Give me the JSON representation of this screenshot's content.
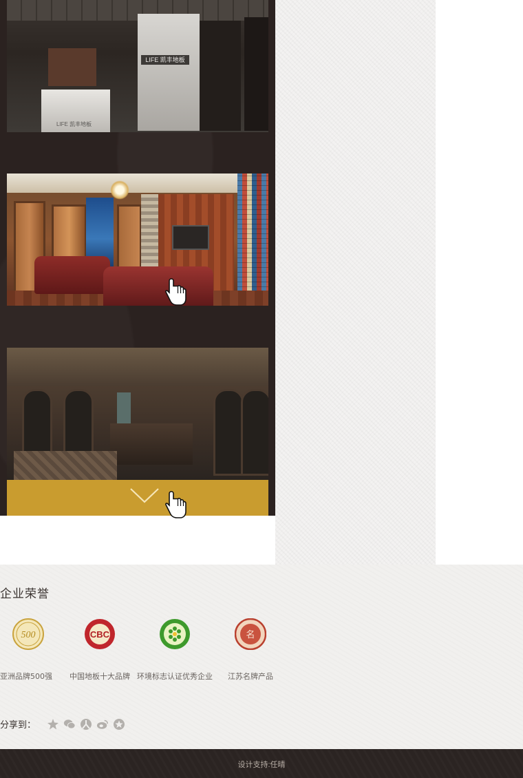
{
  "gallery": {
    "photo1_logo_text": "LIFE 凯丰地板",
    "photo1_desk_text": "LIFE 凯丰地板",
    "scroll_button_icon": "chevron-down-icon"
  },
  "honors": {
    "title": "企业荣誉",
    "awards": [
      {
        "name": "亚洲品牌500强",
        "medal_text": "500"
      },
      {
        "name": "中国地板十大品牌",
        "medal_text": "CBC"
      },
      {
        "name": "环境标志认证优秀企业",
        "medal_text": ""
      },
      {
        "name": "江苏名牌产品",
        "medal_text": "名"
      }
    ]
  },
  "share": {
    "label": "分享到：",
    "icons": [
      "qzone-icon",
      "wechat-icon",
      "renren-icon",
      "weibo-icon",
      "favorite-icon"
    ]
  },
  "footer": {
    "credit": "设计支持:任晴"
  },
  "colors": {
    "gallery_bg": "#2b2220",
    "accent_gold": "#c99c2f",
    "footer_bg": "#2b2422"
  }
}
